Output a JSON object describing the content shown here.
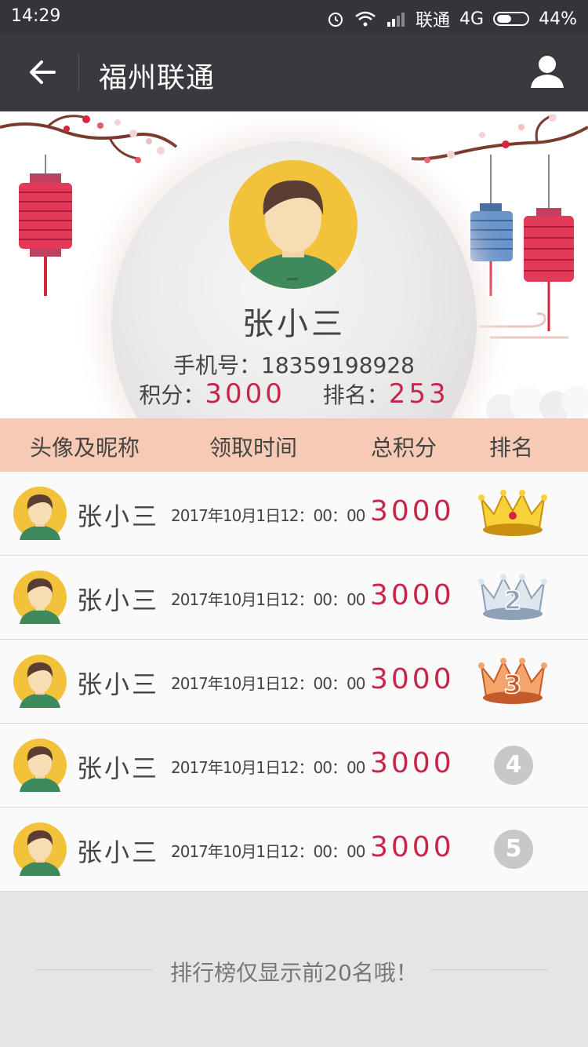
{
  "status_bar": {
    "time": "14:29",
    "carrier": "联通",
    "network": "4G",
    "battery": "44%"
  },
  "nav": {
    "title": "福州联通"
  },
  "profile": {
    "name": "张小三",
    "phone_label": "手机号：",
    "phone": "18359198928",
    "points_label": "积分：",
    "points": "3000",
    "rank_label": "排名：",
    "rank": "253"
  },
  "table": {
    "headers": {
      "avatar_name": "头像及昵称",
      "time": "领取时间",
      "score": "总积分",
      "rank": "排名"
    },
    "rows": [
      {
        "name": "张小三",
        "time": "2017年10月1日12：00：00",
        "score": "3000",
        "rank": "1",
        "rank_icon": "gold-crown-icon"
      },
      {
        "name": "张小三",
        "time": "2017年10月1日12：00：00",
        "score": "3000",
        "rank": "2",
        "rank_icon": "silver-crown-icon"
      },
      {
        "name": "张小三",
        "time": "2017年10月1日12：00：00",
        "score": "3000",
        "rank": "3",
        "rank_icon": "bronze-crown-icon"
      },
      {
        "name": "张小三",
        "time": "2017年10月1日12：00：00",
        "score": "3000",
        "rank": "4",
        "rank_icon": "rank-circle"
      },
      {
        "name": "张小三",
        "time": "2017年10月1日12：00：00",
        "score": "3000",
        "rank": "5",
        "rank_icon": "rank-circle"
      }
    ]
  },
  "footer": {
    "note": "排行榜仅显示前20名哦！"
  },
  "colors": {
    "accent": "#c8254a",
    "header_bg": "#f6cab4",
    "nav_bg": "#393a3f"
  }
}
